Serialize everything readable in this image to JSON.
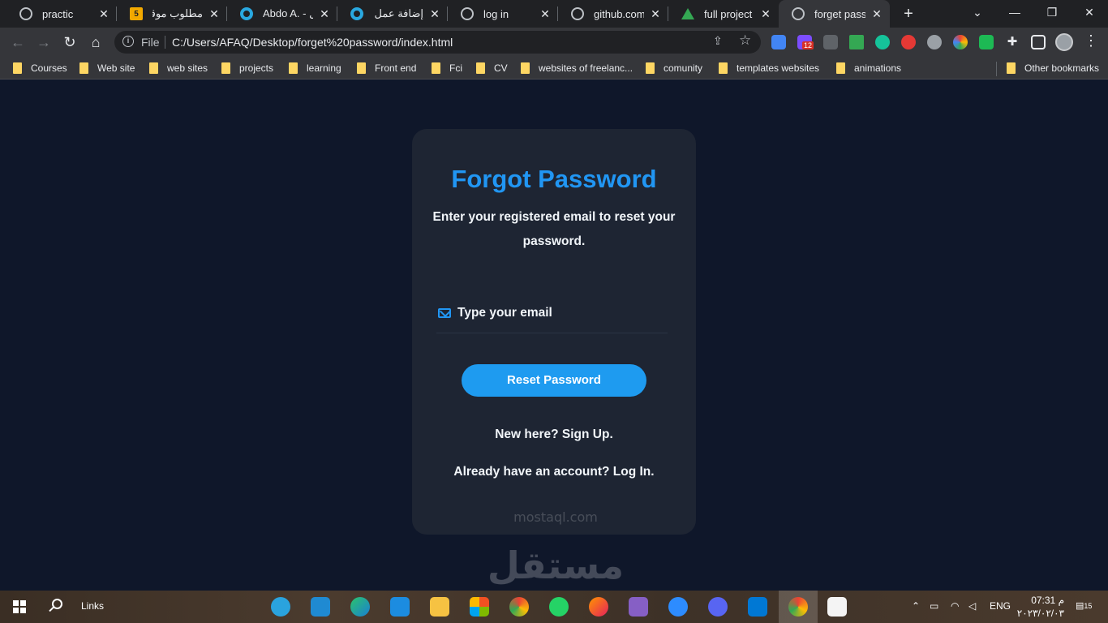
{
  "tabs": [
    {
      "title": "practic",
      "favicon": "globe-icon"
    },
    {
      "title": "مطلوب موقع",
      "favicon": "mostaql-icon",
      "badge": "5"
    },
    {
      "title": "Abdo A. - مستقل",
      "favicon": "mostaql-ring-icon"
    },
    {
      "title": "إضافة عمل جد",
      "favicon": "mostaql-ring-icon"
    },
    {
      "title": "log in",
      "favicon": "globe-icon"
    },
    {
      "title": "github.com",
      "favicon": "globe-icon"
    },
    {
      "title": "full project - G",
      "favicon": "drive-icon"
    },
    {
      "title": "forget passwo",
      "favicon": "globe-icon",
      "active": true
    }
  ],
  "toolbar": {
    "scheme_label": "File",
    "url": "C:/Users/AFAQ/Desktop/forget%20password/index.html",
    "extension_badge": "12"
  },
  "bookmarks": [
    "Courses",
    "Web site",
    "web sites",
    "projects",
    "learning",
    "Front end",
    "Fci",
    "CV",
    "websites of freelanc...",
    "comunity",
    "templates websites",
    "animations"
  ],
  "other_bookmarks": "Other bookmarks",
  "page": {
    "title": "Forgot Password",
    "subtitle": "Enter your registered email to reset your password.",
    "email_placeholder": "Type your email",
    "reset_button": "Reset Password",
    "signup_link": "New here? Sign Up.",
    "login_link": "Already have an account? Log In."
  },
  "watermark": {
    "arabic": "مستقل",
    "latin": "mostaql.com"
  },
  "taskbar": {
    "links_label": "Links",
    "lang": "ENG",
    "time": "07:31 م",
    "date": "٢٠٢٣/٠٢/٠٣",
    "notification_count": "15"
  },
  "colors": {
    "page_bg": "#0f172a",
    "card_bg": "#1e2533",
    "accent": "#2196f3",
    "button": "#1e9bf0"
  }
}
